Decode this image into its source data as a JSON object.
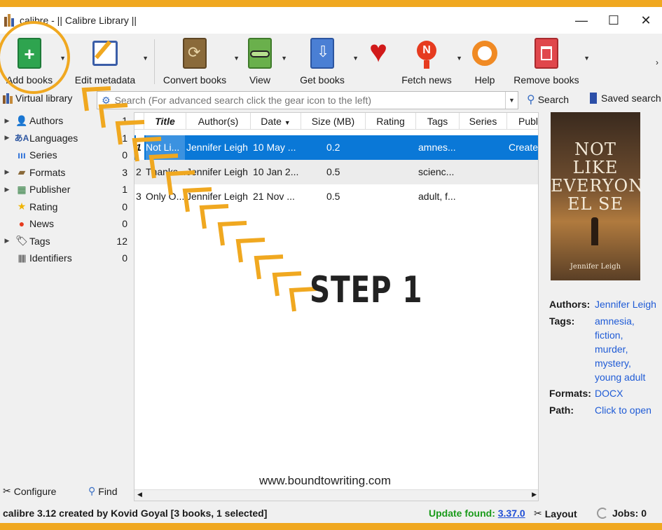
{
  "window": {
    "title": "calibre - || Calibre Library ||",
    "minimize": "—",
    "maximize": "☐",
    "close": "✕"
  },
  "toolbar": {
    "add_books": "Add books",
    "edit_metadata": "Edit metadata",
    "convert_books": "Convert books",
    "view": "View",
    "get_books": "Get books",
    "fetch_news": "Fetch news",
    "help": "Help",
    "remove_books": "Remove books",
    "more": "›"
  },
  "search": {
    "virtual_library": "Virtual library",
    "placeholder": "Search (For advanced search click the gear icon to the left)",
    "search_button": "Search",
    "saved_search": "Saved search"
  },
  "tag_browser": {
    "items": [
      {
        "label": "Authors",
        "count": "1",
        "icon": "person-icon",
        "expandable": true
      },
      {
        "label": "Languages",
        "count": "1",
        "icon": "languages-icon",
        "expandable": true
      },
      {
        "label": "Series",
        "count": "0",
        "icon": "series-icon",
        "expandable": false
      },
      {
        "label": "Formats",
        "count": "3",
        "icon": "formats-icon",
        "expandable": true
      },
      {
        "label": "Publisher",
        "count": "1",
        "icon": "publisher-icon",
        "expandable": true
      },
      {
        "label": "Rating",
        "count": "0",
        "icon": "star-icon",
        "expandable": false
      },
      {
        "label": "News",
        "count": "0",
        "icon": "news-icon",
        "expandable": false
      },
      {
        "label": "Tags",
        "count": "12",
        "icon": "tag-icon",
        "expandable": true
      },
      {
        "label": "Identifiers",
        "count": "0",
        "icon": "barcode-icon",
        "expandable": false
      }
    ],
    "configure": "Configure",
    "find": "Find"
  },
  "book_list": {
    "columns": [
      "Title",
      "Author(s)",
      "Date",
      "Size (MB)",
      "Rating",
      "Tags",
      "Series",
      "Publi"
    ],
    "rows": [
      {
        "num": "1",
        "title": "Not Li...",
        "author": "Jennifer Leigh",
        "date": "10 May ...",
        "size": "0.2",
        "rating": "",
        "tags": "amnes...",
        "series": "",
        "publisher": "Create"
      },
      {
        "num": "2",
        "title": "Thanks...",
        "author": "Jennifer Leigh",
        "date": "10 Jan 2...",
        "size": "0.5",
        "rating": "",
        "tags": "scienc...",
        "series": "",
        "publisher": ""
      },
      {
        "num": "3",
        "title": "Only O...",
        "author": "Jennifer Leigh",
        "date": "21 Nov ...",
        "size": "0.5",
        "rating": "",
        "tags": "adult, f...",
        "series": "",
        "publisher": ""
      }
    ]
  },
  "details": {
    "cover_title": "NOT LIKE EVERYONE EL SE",
    "cover_author": "Jennifer Leigh",
    "authors_label": "Authors:",
    "authors_value": "Jennifer Leigh",
    "tags_label": "Tags:",
    "tags": [
      "amnesia,",
      "fiction,",
      "murder,",
      "mystery,",
      "young adult"
    ],
    "formats_label": "Formats:",
    "formats_value": "DOCX",
    "path_label": "Path:",
    "path_value": "Click to open"
  },
  "status": {
    "left": "calibre 3.12 created by Kovid Goyal   [3 books, 1 selected]",
    "update_label": "Update found:",
    "update_version": "3.37.0",
    "layout": "Layout",
    "jobs": "Jobs: 0"
  },
  "annotation": {
    "step": "STEP 1",
    "watermark": "www.boundtowriting.com",
    "accent": "#f0a820"
  }
}
